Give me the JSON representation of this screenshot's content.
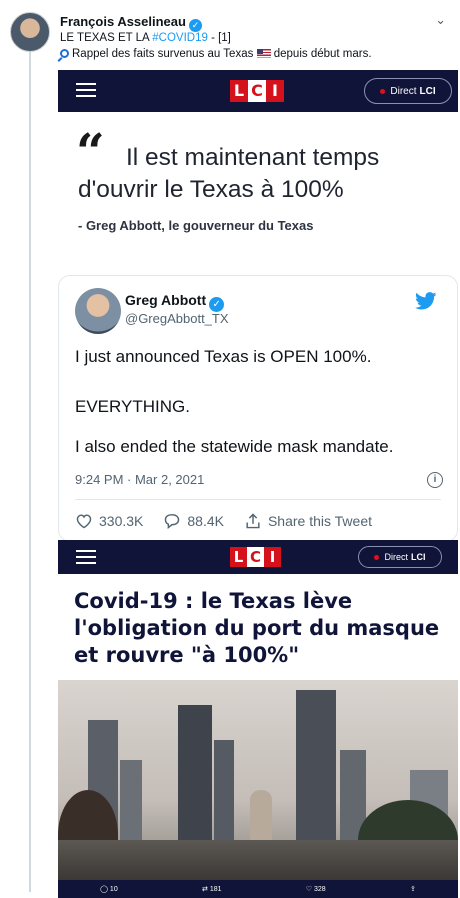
{
  "tweet": {
    "author_name": "François Asselineau",
    "line1_prefix": "LE TEXAS ET LA ",
    "line1_hashtag": "#COVID19",
    "line1_suffix": " - [1]",
    "line2_before_flag": "Rappel des faits survenus au Texas",
    "line2_after_flag": " depuis début mars."
  },
  "lci_header_top": {
    "logo_letters": [
      "L",
      "C",
      "I"
    ],
    "direct_label": "Direct",
    "direct_brand": "LCI"
  },
  "quote": {
    "mark": "“",
    "text": "Il est maintenant temps d'ouvrir le Texas à 100%",
    "attribution": "- Greg Abbott, le gouverneur du Texas"
  },
  "embedded_tweet": {
    "name": "Greg Abbott",
    "handle": "@GregAbbott_TX",
    "line1": "I just announced Texas is OPEN 100%.",
    "line2": "EVERYTHING.",
    "line3": "I also ended the statewide mask mandate.",
    "timestamp": "9:24 PM · Mar 2, 2021",
    "likes": "330.3K",
    "replies": "88.4K",
    "share_label": "Share this Tweet"
  },
  "lci_header_bottom": {
    "logo_letters": [
      "L",
      "C",
      "I"
    ],
    "direct_label": "Direct",
    "direct_brand": "LCI"
  },
  "article": {
    "title": "Covid-19 : le Texas lève l'obligation du port du masque et rouvre \"à 100%\""
  },
  "photo_bar": {
    "comments": "10",
    "retweets": "181",
    "likes": "328"
  },
  "colors": {
    "lci_navy": "#101439",
    "lci_red": "#d5121c",
    "twitter_blue": "#1d9bf0"
  }
}
